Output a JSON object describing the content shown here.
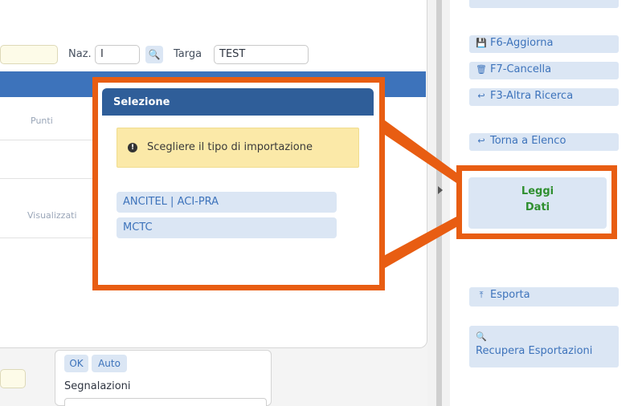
{
  "form": {
    "naz_label": "Naz.",
    "naz_value": "I",
    "targa_label": "Targa",
    "targa_value": "TEST",
    "tab_punti": "Punti",
    "tab_visualizzati": "Visualizzati"
  },
  "bottom": {
    "ok_label": "OK",
    "auto_label": "Auto",
    "segnalazioni_label": "Segnalazioni"
  },
  "actions": {
    "aggiorna": "F6-Aggiorna",
    "cancella": "F7-Cancella",
    "altra_ricerca": "F3-Altra Ricerca",
    "torna_elenco": "Torna a Elenco",
    "leggi_line1": "Leggi",
    "leggi_line2": "Dati",
    "esporta": "Esporta",
    "recupera": "Recupera Esportazioni"
  },
  "dialog": {
    "title": "Selezione",
    "message": "Scegliere il tipo di importazione",
    "options": [
      "ANCITEL | ACI-PRA",
      "MCTC"
    ]
  },
  "colors": {
    "accent": "#3d73bb",
    "highlight": "#e85d12",
    "message_bg": "#fbe9a8",
    "leggi_text": "#2f8f2f"
  }
}
